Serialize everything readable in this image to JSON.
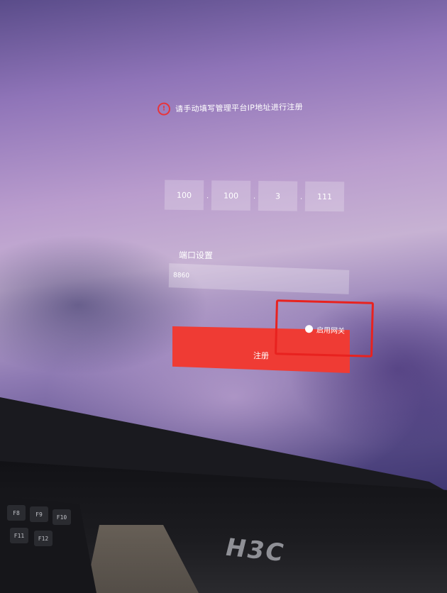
{
  "notice": {
    "icon": "alert-circle-icon",
    "text": "请手动填写管理平台IP地址进行注册"
  },
  "ip": {
    "octets": [
      "100",
      "100",
      "3",
      "111"
    ],
    "separator": "."
  },
  "port": {
    "label": "端口设置",
    "value": "8860"
  },
  "gateway": {
    "label": "启用网关",
    "checked": true
  },
  "register": {
    "label": "注册"
  },
  "hardware": {
    "brand": "H3C",
    "keys": [
      "F8",
      "F9",
      "F10",
      "F11",
      "F12"
    ]
  },
  "colors": {
    "accent": "#ef3b34",
    "highlight": "#e8221f"
  }
}
